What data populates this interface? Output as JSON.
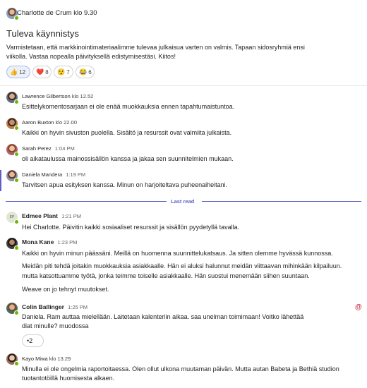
{
  "post": {
    "author": "Charlotte de Crum",
    "time": "klo 9.30",
    "title": "Tuleva käynnistys",
    "body_line1": "Varmistetaan, että markkinointimateriaalimme tulevaa julkaisua varten on valmis. Tapaan sidosryhmiä ensi",
    "body_line2": "viikolla. Vastaa nopealla päivityksellä edistymisestäsi. Kiitos!",
    "reactions": [
      {
        "emoji": "👍",
        "count": "12"
      },
      {
        "emoji": "❤️",
        "count": "8"
      },
      {
        "emoji": "😯",
        "count": "7"
      },
      {
        "emoji": "😂",
        "count": "6"
      }
    ]
  },
  "messages": [
    {
      "author": "Lawrence Gilbertson",
      "time": "klo 12.52",
      "text": "Esittelykomentosarjaan ei ole enää muokkauksia ennen tapahtumaistuntoa."
    },
    {
      "author": "Aaron Buxton",
      "time": "klo 22.00",
      "text": "Kaikki on hyvin sivuston puolella. Sisältö ja resurssit ovat valmiita julkaista."
    },
    {
      "author": "Sarah Perez",
      "time": "1:04 PM",
      "text": "oli aikataulussa mainossisällön kanssa ja jakaa sen suunnitelmien mukaan."
    },
    {
      "author": "Daniela Mandera",
      "time": "1:19 PM",
      "text": "Tarvitsen apua esityksen kanssa. Minun on harjoiteltava puheenaiheitani."
    }
  ],
  "last_read_label": "Last read",
  "unread": [
    {
      "author": "Edmee Plant",
      "initials": "EP",
      "time": "1:21 PM",
      "lines": [
        "Hei Charlotte. Päivitin kaikki sosiaaliset resurssit ja sisällön pyydetyllä tavalla."
      ]
    },
    {
      "author": "Mona Kane",
      "time": "1:23 PM",
      "lines": [
        "Kaikki on hyvin minun päässäni. Meillä on huomenna suunnittelukatsaus. Ja sitten olemme hyvässä kunnossa.",
        "Meidän piti tehdä joitakin muokkauksia asiakkaalle. Hän ei aluksi halunnut meidän viittaavan mihinkään kilpailuun.",
        "mutta katsottuamme työtä, jonka teimme toiselle asiakkaalle. Hän suostui menemään siihen suuntaan.",
        "Weave on jo tehnyt muutokset."
      ]
    },
    {
      "author": "Colin Ballinger",
      "time": "1:25 PM",
      "lines": [
        "Daniela. Ram auttaa mielellään. Laitetaan kalenteriin aikaa. saa unelman toimimaan! Voitko lähettää",
        "diat minulle? muodossa"
      ],
      "reaction": "•2",
      "mention": "@"
    },
    {
      "author": "Kayo Miwa",
      "time": "klo 13.29",
      "lines": [
        "Minulla ei ole ongelmia raportoitaessa. Olen ollut ulkona muutaman päivän.  Mutta autan Babeta ja Bethiä studion",
        "tuotantotöillä huomisesta alkaen."
      ]
    }
  ],
  "colors": {
    "accent": "#5b5fc7",
    "presence": "#6bb700",
    "mention": "#c4314b"
  }
}
